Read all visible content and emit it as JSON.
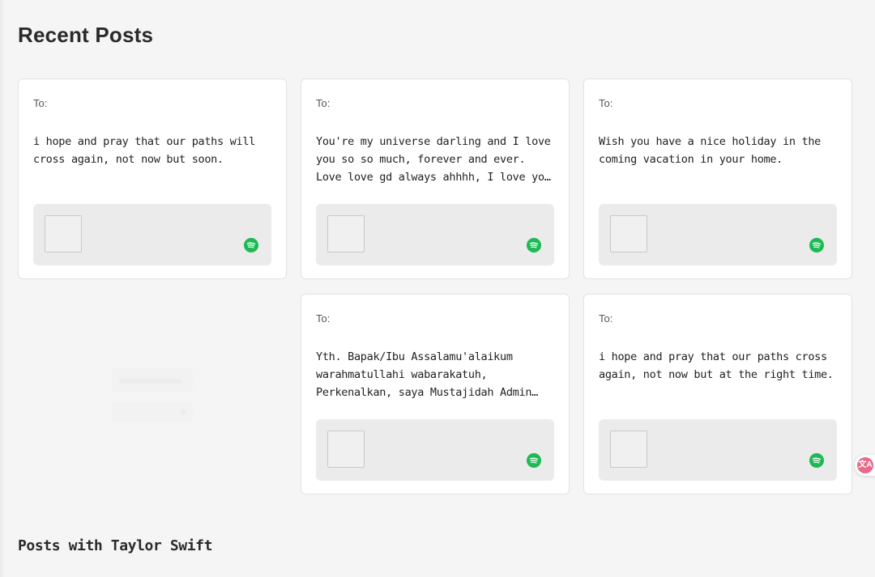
{
  "recent_posts": {
    "title": "Recent Posts",
    "cards": [
      {
        "to_label": "To:",
        "message": "i hope and pray that our paths will cross again, not now but soon."
      },
      {
        "to_label": "To:",
        "message": "You're my universe darling and I love you so so much, forever and ever. Love love gd always ahhhh, I love you so much"
      },
      {
        "to_label": "To:",
        "message": "Wish you have a nice holiday in the coming vacation in your home."
      },
      {
        "to_label": "To:",
        "message": "Yth. Bapak/Ibu Assalamu'alaikum warahmatullahi wabarakatuh, Perkenalkan, saya Mustajidah Admin dari"
      },
      {
        "to_label": "To:",
        "message": "i hope and pray that our paths cross again, not now but at the right time."
      }
    ]
  },
  "taylor_section": {
    "title": "Posts with Taylor Swift"
  },
  "icons": {
    "track_thumbnail": "album-art-placeholder",
    "music_service": "spotify-icon",
    "translate": "translate-icon"
  },
  "colors": {
    "spotify_green": "#1db954",
    "translate_pink": "#e86a8a"
  }
}
